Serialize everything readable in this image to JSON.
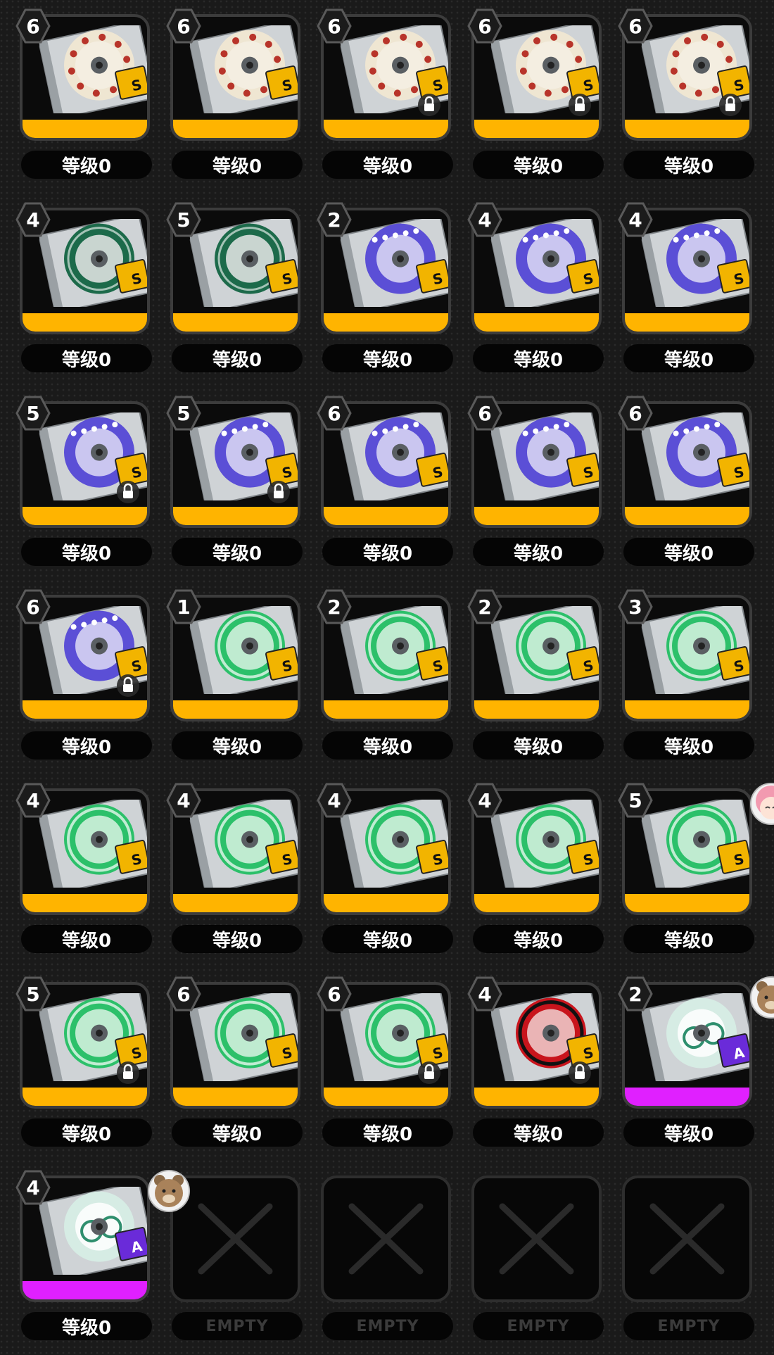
{
  "colors": {
    "band_s": "#ffb400",
    "band_a": "#e020ff",
    "card_border": "#3c3c3c"
  },
  "items": [
    {
      "level": "6",
      "label": "等级0",
      "disc": "star",
      "rarity": "S",
      "locked": false,
      "avatar": null
    },
    {
      "level": "6",
      "label": "等级0",
      "disc": "star",
      "rarity": "S",
      "locked": false,
      "avatar": null
    },
    {
      "level": "6",
      "label": "等级0",
      "disc": "star",
      "rarity": "S",
      "locked": true,
      "avatar": null
    },
    {
      "level": "6",
      "label": "等级0",
      "disc": "star",
      "rarity": "S",
      "locked": true,
      "avatar": null
    },
    {
      "level": "6",
      "label": "等级0",
      "disc": "star",
      "rarity": "S",
      "locked": true,
      "avatar": null
    },
    {
      "level": "4",
      "label": "等级0",
      "disc": "oxo",
      "rarity": "S",
      "locked": false,
      "avatar": null
    },
    {
      "level": "5",
      "label": "等级0",
      "disc": "oxo",
      "rarity": "S",
      "locked": false,
      "avatar": null
    },
    {
      "level": "2",
      "label": "等级0",
      "disc": "blue",
      "rarity": "S",
      "locked": false,
      "avatar": null
    },
    {
      "level": "4",
      "label": "等级0",
      "disc": "blue",
      "rarity": "S",
      "locked": false,
      "avatar": null
    },
    {
      "level": "4",
      "label": "等级0",
      "disc": "blue",
      "rarity": "S",
      "locked": false,
      "avatar": null
    },
    {
      "level": "5",
      "label": "等级0",
      "disc": "blue",
      "rarity": "S",
      "locked": true,
      "avatar": null
    },
    {
      "level": "5",
      "label": "等级0",
      "disc": "blue",
      "rarity": "S",
      "locked": true,
      "avatar": null
    },
    {
      "level": "6",
      "label": "等级0",
      "disc": "blue",
      "rarity": "S",
      "locked": false,
      "avatar": null
    },
    {
      "level": "6",
      "label": "等级0",
      "disc": "blue",
      "rarity": "S",
      "locked": false,
      "avatar": null
    },
    {
      "level": "6",
      "label": "等级0",
      "disc": "blue",
      "rarity": "S",
      "locked": false,
      "avatar": null
    },
    {
      "level": "6",
      "label": "等级0",
      "disc": "blue",
      "rarity": "S",
      "locked": true,
      "avatar": null
    },
    {
      "level": "1",
      "label": "等级0",
      "disc": "green",
      "rarity": "S",
      "locked": false,
      "avatar": null
    },
    {
      "level": "2",
      "label": "等级0",
      "disc": "green",
      "rarity": "S",
      "locked": false,
      "avatar": null
    },
    {
      "level": "2",
      "label": "等级0",
      "disc": "green",
      "rarity": "S",
      "locked": false,
      "avatar": null
    },
    {
      "level": "3",
      "label": "等级0",
      "disc": "green",
      "rarity": "S",
      "locked": false,
      "avatar": null
    },
    {
      "level": "4",
      "label": "等级0",
      "disc": "green",
      "rarity": "S",
      "locked": false,
      "avatar": null
    },
    {
      "level": "4",
      "label": "等级0",
      "disc": "green",
      "rarity": "S",
      "locked": false,
      "avatar": null
    },
    {
      "level": "4",
      "label": "等级0",
      "disc": "green",
      "rarity": "S",
      "locked": false,
      "avatar": null
    },
    {
      "level": "4",
      "label": "等级0",
      "disc": "green",
      "rarity": "S",
      "locked": false,
      "avatar": null
    },
    {
      "level": "5",
      "label": "等级0",
      "disc": "green",
      "rarity": "S",
      "locked": false,
      "avatar": "pink-hair-girl"
    },
    {
      "level": "5",
      "label": "等级0",
      "disc": "green",
      "rarity": "S",
      "locked": true,
      "avatar": null
    },
    {
      "level": "6",
      "label": "等级0",
      "disc": "green",
      "rarity": "S",
      "locked": false,
      "avatar": null
    },
    {
      "level": "6",
      "label": "等级0",
      "disc": "green",
      "rarity": "S",
      "locked": true,
      "avatar": null
    },
    {
      "level": "4",
      "label": "等级0",
      "disc": "red",
      "rarity": "S",
      "locked": true,
      "avatar": null
    },
    {
      "level": "2",
      "label": "等级0",
      "disc": "freedom",
      "rarity": "A",
      "locked": false,
      "avatar": "bear"
    },
    {
      "level": "4",
      "label": "等级0",
      "disc": "freedom",
      "rarity": "A",
      "locked": false,
      "avatar": "bear"
    },
    {
      "empty": true,
      "label": "EMPTY"
    },
    {
      "empty": true,
      "label": "EMPTY"
    },
    {
      "empty": true,
      "label": "EMPTY"
    },
    {
      "empty": true,
      "label": "EMPTY"
    }
  ]
}
